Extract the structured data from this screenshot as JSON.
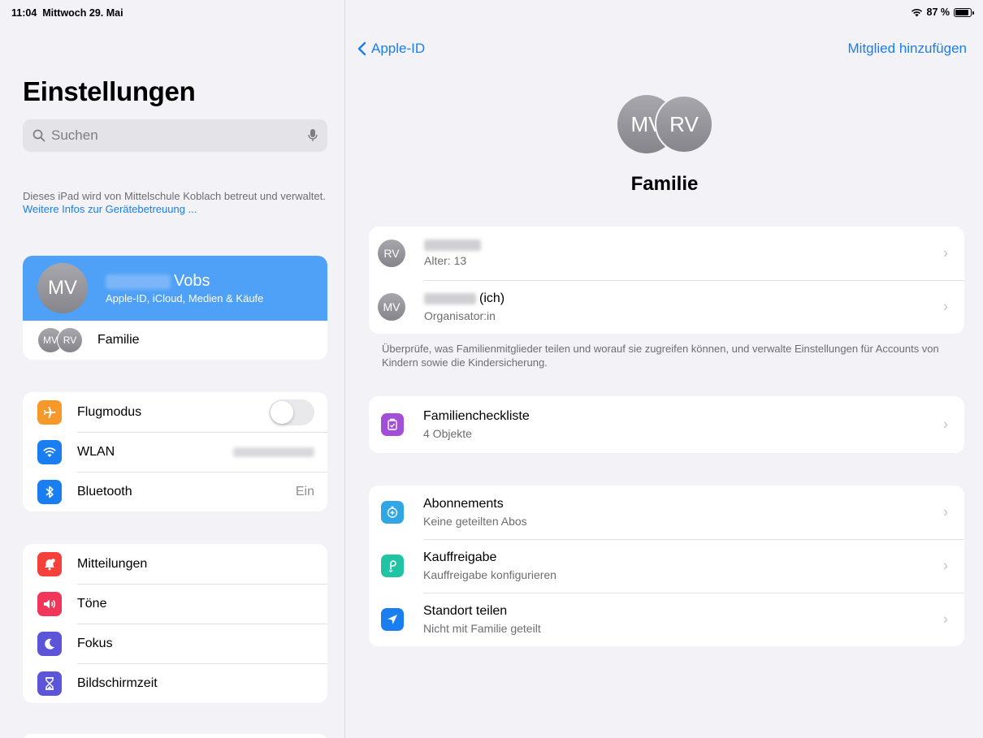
{
  "status": {
    "time": "11:04",
    "date": "Mittwoch 29. Mai",
    "battery": "87 %",
    "battery_level": 0.87
  },
  "sidebar": {
    "title": "Einstellungen",
    "search_placeholder": "Suchen",
    "managed_text": "Dieses iPad wird von Mittelschule Koblach betreut und verwaltet.",
    "managed_link": "Weitere Infos zur Gerätebetreuung ...",
    "profile": {
      "initials": "MV",
      "name": "Vobs",
      "subtitle": "Apple-ID, iCloud, Medien & Käufe"
    },
    "family": {
      "initials_1": "MV",
      "initials_2": "RV",
      "label": "Familie"
    },
    "connectivity": [
      {
        "label": "Flugmodus",
        "icon": "airplane-icon",
        "color": "#f7982a"
      },
      {
        "label": "WLAN",
        "icon": "wifi-icon",
        "color": "#1a7ef0"
      },
      {
        "label": "Bluetooth",
        "icon": "bluetooth-icon",
        "color": "#1a7ef0",
        "value": "Ein"
      }
    ],
    "notifications": [
      {
        "label": "Mitteilungen",
        "icon": "notification-bell-icon",
        "color": "#f5413a"
      },
      {
        "label": "Töne",
        "icon": "speaker-icon",
        "color": "#f2365a"
      },
      {
        "label": "Fokus",
        "icon": "moon-icon",
        "color": "#5c55d9"
      },
      {
        "label": "Bildschirmzeit",
        "icon": "hourglass-icon",
        "color": "#5c55d9"
      }
    ]
  },
  "detail": {
    "back_label": "Apple-ID",
    "add_member": "Mitglied hinzufügen",
    "hero_initials_1": "MV",
    "hero_initials_2": "RV",
    "title": "Familie",
    "members": [
      {
        "initials": "RV",
        "subtitle": "Alter: 13"
      },
      {
        "initials": "MV",
        "name_suffix": "(ich)",
        "subtitle": "Organisator:in"
      }
    ],
    "footnote": "Überprüfe, was Familienmitglieder teilen und worauf sie zugreifen können, und verwalte Einstellungen für Accounts von Kindern sowie die Kindersicherung.",
    "checklist": {
      "title": "Familiencheckliste",
      "subtitle": "4 Objekte",
      "icon": "checklist-icon",
      "color": "#a24fd8"
    },
    "sharing": [
      {
        "title": "Abonnements",
        "subtitle": "Keine geteilten Abos",
        "icon": "subscriptions-icon",
        "color": "#30a6e4"
      },
      {
        "title": "Kauffreigabe",
        "subtitle": "Kauffreigabe konfigurieren",
        "icon": "purchase-sharing-icon",
        "color": "#20c4a4"
      },
      {
        "title": "Standort teilen",
        "subtitle": "Nicht mit Familie geteilt",
        "icon": "location-arrow-icon",
        "color": "#1a7ef0"
      }
    ]
  }
}
